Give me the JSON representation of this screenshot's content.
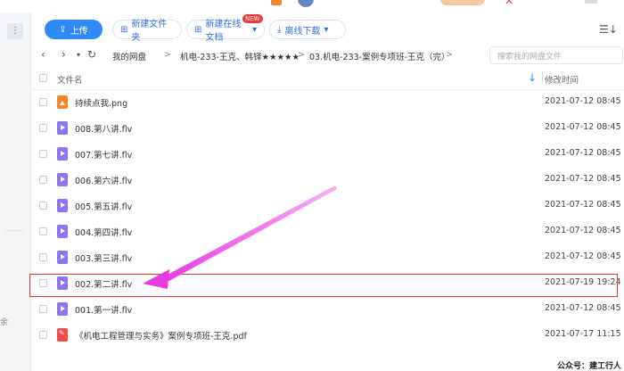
{
  "toolbar": {
    "upload": "上传",
    "new_folder": "新建文件夹",
    "new_online_doc": "新建在线文档",
    "new_badge": "NEW",
    "offline_download": "离线下载"
  },
  "nav": {
    "breadcrumbs": [
      "我的网盘",
      "机电-233-王克、韩铎★★★★★",
      "03.机电-233-案例专项班-王克（完）"
    ],
    "search_placeholder": "搜索我的网盘文件"
  },
  "table": {
    "headers": {
      "name": "文件名",
      "modified": "修改时间"
    },
    "rows": [
      {
        "name": "持续点我.png",
        "date": "2021-07-12 08:45",
        "icon": "image-icon"
      },
      {
        "name": "008.第八讲.flv",
        "date": "2021-07-12 08:45",
        "icon": "video-icon"
      },
      {
        "name": "007.第七讲.flv",
        "date": "2021-07-12 08:45",
        "icon": "video-icon"
      },
      {
        "name": "006.第六讲.flv",
        "date": "2021-07-12 08:45",
        "icon": "video-icon"
      },
      {
        "name": "005.第五讲.flv",
        "date": "2021-07-12 08:45",
        "icon": "video-icon"
      },
      {
        "name": "004.第四讲.flv",
        "date": "2021-07-12 08:45",
        "icon": "video-icon"
      },
      {
        "name": "003.第三讲.flv",
        "date": "2021-07-12 08:45",
        "icon": "video-icon"
      },
      {
        "name": "002.第二讲.flv",
        "date": "2021-07-19 19:24",
        "icon": "video-icon"
      },
      {
        "name": "001.第一讲.flv",
        "date": "2021-07-12 08:45",
        "icon": "video-icon"
      },
      {
        "name": "《机电工程管理与实务》案例专项班-王克.pdf",
        "date": "2021-07-17 11:15",
        "icon": "pdf-icon"
      }
    ]
  },
  "sidebar": {
    "partial_label": "余"
  },
  "watermark": "公众号：建工行人",
  "colors": {
    "accent": "#2f8af7",
    "highlight": "#e23a3a",
    "arrow": "#e63ce0"
  }
}
